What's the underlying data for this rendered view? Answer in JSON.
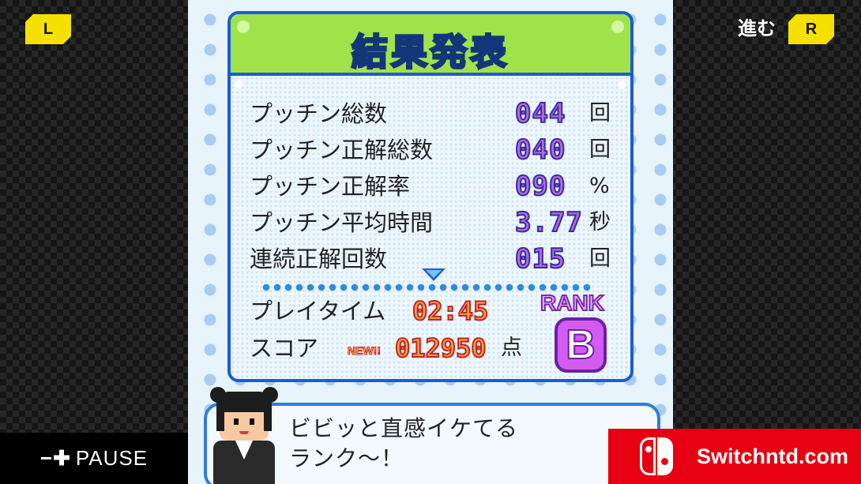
{
  "controls": {
    "left_button": "L",
    "right_button": "R",
    "advance_label": "進む",
    "pause_symbols": "−✚",
    "pause_label": "PAUSE"
  },
  "panel": {
    "title": "結果発表",
    "stats": [
      {
        "label": "プッチン総数",
        "value": "044",
        "unit": "回"
      },
      {
        "label": "プッチン正解総数",
        "value": "040",
        "unit": "回"
      },
      {
        "label": "プッチン正解率",
        "value": "090",
        "unit": "%"
      },
      {
        "label": "プッチン平均時間",
        "value": "3.77",
        "unit": "秒"
      },
      {
        "label": "連続正解回数",
        "value": "015",
        "unit": "回"
      }
    ],
    "playtime": {
      "label": "プレイタイム",
      "value": "02:45"
    },
    "score": {
      "label": "スコア",
      "new_badge": "NEW!!",
      "value": "012950",
      "unit": "点"
    },
    "rank": {
      "label": "RANK",
      "value": "B"
    }
  },
  "dialogue": {
    "text": "ビビッと直感イケてる\nランク〜！"
  },
  "watermark": {
    "text": "Switchntd.com"
  },
  "colors": {
    "header_green": "#9fe24a",
    "border_blue": "#1a5cd6",
    "stat_purple": "#b26ae8",
    "score_orange": "#f7a33a",
    "rank_magenta": "#d35cf0",
    "badge_yellow": "#f6e000",
    "watermark_red": "#e60012"
  },
  "icons": {
    "scroll_indicator": "triangle-down-icon",
    "console_logo": "switch-logo-icon"
  }
}
